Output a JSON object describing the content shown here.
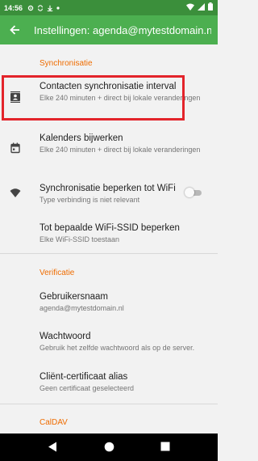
{
  "status_bar": {
    "time": "14:56",
    "left_icons": [
      "settings-icon",
      "sync-icon",
      "download-icon",
      "dot-icon"
    ],
    "right_icons": [
      "wifi-icon",
      "signal-icon",
      "battery-icon"
    ]
  },
  "app_bar": {
    "title": "Instellingen: agenda@mytestdomain.nl"
  },
  "sections": {
    "sync": {
      "header": "Synchronisatie"
    },
    "verification": {
      "header": "Verificatie"
    },
    "caldav": {
      "header": "CalDAV"
    }
  },
  "items": {
    "contacts_interval": {
      "title": "Contacten synchronisatie interval",
      "summary": "Elke 240 minuten + direct bij lokale veranderingen",
      "icon": "contacts-icon"
    },
    "calendars_update": {
      "title": "Kalenders bijwerken",
      "summary": "Elke 240 minuten + direct bij lokale veranderingen",
      "icon": "calendar-icon"
    },
    "wifi_only": {
      "title": "Synchronisatie beperken tot WiFi",
      "summary": "Type verbinding is niet relevant",
      "icon": "wifi-icon",
      "enabled": false
    },
    "wifi_ssid": {
      "title": "Tot bepaalde WiFi-SSID beperken",
      "summary": "Elke WiFi-SSID toestaan"
    },
    "username": {
      "title": "Gebruikersnaam",
      "summary": "agenda@mytestdomain.nl"
    },
    "password": {
      "title": "Wachtwoord",
      "summary": "Gebruik het zelfde wachtwoord als op de server."
    },
    "client_cert": {
      "title": "Cliënt-certificaat alias",
      "summary": "Geen certificaat geselecteerd"
    }
  },
  "colors": {
    "status_bar": "#3b8f3b",
    "app_bar": "#4caf50",
    "section_header": "#ef6c00",
    "highlight": "#e3242b"
  }
}
